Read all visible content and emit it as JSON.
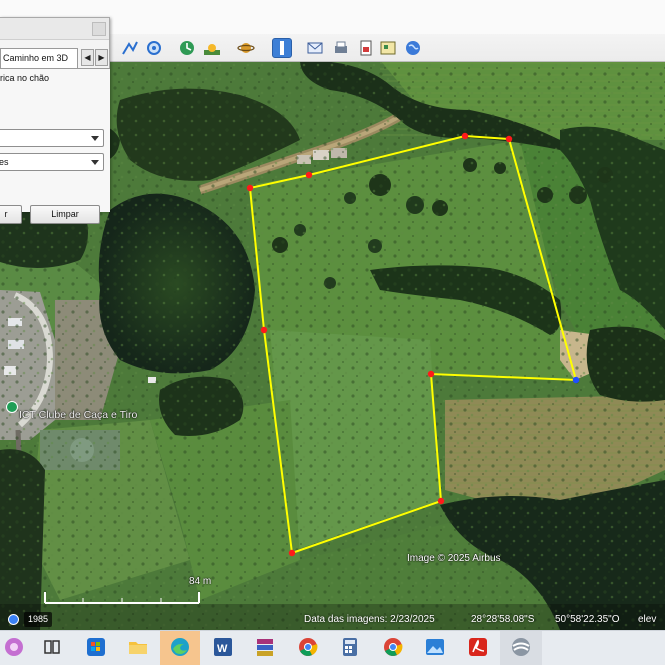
{
  "panel": {
    "tab_label": "Caminho em 3D",
    "tab_prev": "◀",
    "tab_next": "▶",
    "clamp_label": "rica no chão",
    "dropdown1_value": "",
    "dropdown2_value": "es",
    "button_left_label": "r",
    "button_clear_label": "Limpar"
  },
  "map": {
    "place_name": "ICT Clube de Caça e Tiro",
    "copyright": "Image © 2025 Airbus",
    "scale_label": "84 m",
    "year": "1985",
    "imagery_date": "Data das imagens: 2/23/2025",
    "latitude": "28°28'58.08\"S",
    "longitude": "50°58'22.35\"O",
    "elev_label": "elev"
  },
  "toolbar": {
    "icons": [
      "add-path-icon",
      "add-circle-icon",
      "historical-imagery-icon",
      "sunlight-icon",
      "planets-icon",
      "ruler-icon",
      "email-icon",
      "print-icon",
      "save-image-icon",
      "view-in-maps-icon",
      "earth-icon"
    ]
  },
  "taskbar": {
    "icons": [
      "start-icon",
      "task-view-icon",
      "store-icon",
      "file-explorer-icon",
      "edge-icon",
      "word-icon",
      "winrar-icon",
      "chrome-icon",
      "calculator-icon",
      "chrome-profile-icon",
      "photos-icon",
      "acrobat-icon",
      "google-earth-icon"
    ]
  },
  "colors": {
    "path_line": "#ffff00",
    "vertex": "#ff1a1a",
    "selected_vertex": "#1f4fff",
    "taskbar_active": "#f6c58e"
  }
}
